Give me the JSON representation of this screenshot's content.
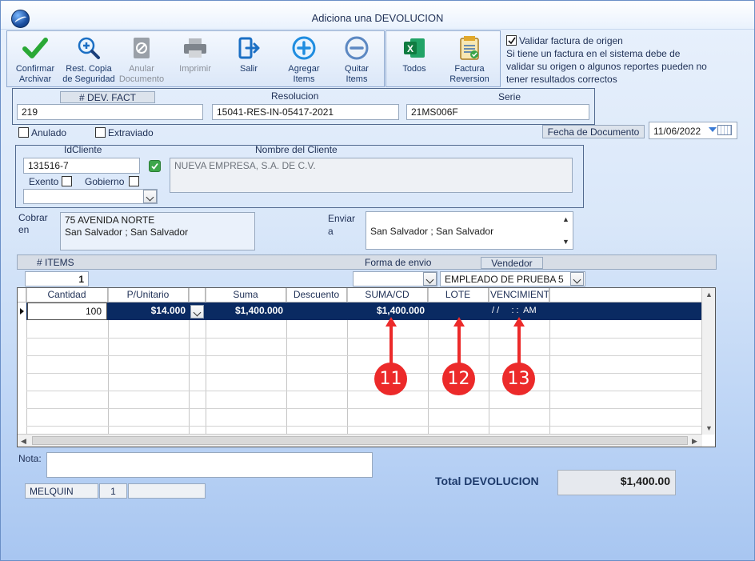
{
  "window": {
    "title": "Adiciona una DEVOLUCION"
  },
  "toolbar": {
    "confirm": "Confirmar\nArchivar",
    "restore": "Rest. Copia\nde Seguridad",
    "void": "Anular\nDocumento",
    "print": "Imprimir",
    "exit": "Salir",
    "add": "Agregar\nItems",
    "remove": "Quitar\nItems",
    "all": "Todos",
    "invoice": "Factura\nReversion"
  },
  "validate": {
    "label": "Validar factura de origen",
    "note": "Si tiene un factura en el sistema debe de validar su origen o algunos reportes pueden no tener resultados correctos"
  },
  "doc": {
    "dev_header": "# DEV. FACT",
    "dev_value": "219",
    "resolucion_label": "Resolucion",
    "resolucion_value": "15041-RES-IN-05417-2021",
    "serie_label": "Serie",
    "serie_value": "21MS006F"
  },
  "flags": {
    "anulado": "Anulado",
    "extraviado": "Extraviado"
  },
  "date": {
    "label": "Fecha de  Documento",
    "value": "11/06/2022"
  },
  "client": {
    "id_label": "IdCliente",
    "id_value": "131516-7",
    "name_label": "Nombre del Cliente",
    "name_value": "NUEVA EMPRESA, S.A. DE C.V.",
    "exento": "Exento",
    "gobierno": "Gobierno"
  },
  "address": {
    "cobrar_label": "Cobrar\nen",
    "cobrar_value": "75 AVENIDA NORTE\nSan Salvador ; San Salvador",
    "enviar_label": "Enviar\na",
    "enviar_value": "San Salvador ; San Salvador"
  },
  "items_bar": {
    "items_label": "# ITEMS",
    "items_value": "1",
    "forma_label": "Forma de envio",
    "vendedor_label": "Vendedor",
    "vendedor_value": "EMPLEADO DE PRUEBA 5"
  },
  "grid": {
    "columns": [
      "Cantidad",
      "P/Unitario",
      "Suma",
      "Descuento",
      "SUMA/CD",
      "LOTE",
      "VENCIMIENTO"
    ],
    "row": {
      "cantidad": "100",
      "punitario": "$14.000",
      "suma": "$1,400.000",
      "descuento": "",
      "sumacd": "$1,400.000",
      "lote": "",
      "vencimiento": "/ /     : :  AM"
    }
  },
  "markers": [
    "11",
    "12",
    "13"
  ],
  "nota": {
    "label": "Nota:",
    "value": ""
  },
  "footer": {
    "user": "MELQUIN",
    "num": "1",
    "extra": ""
  },
  "total": {
    "label": "Total DEVOLUCION",
    "value": "$1,400.00"
  }
}
